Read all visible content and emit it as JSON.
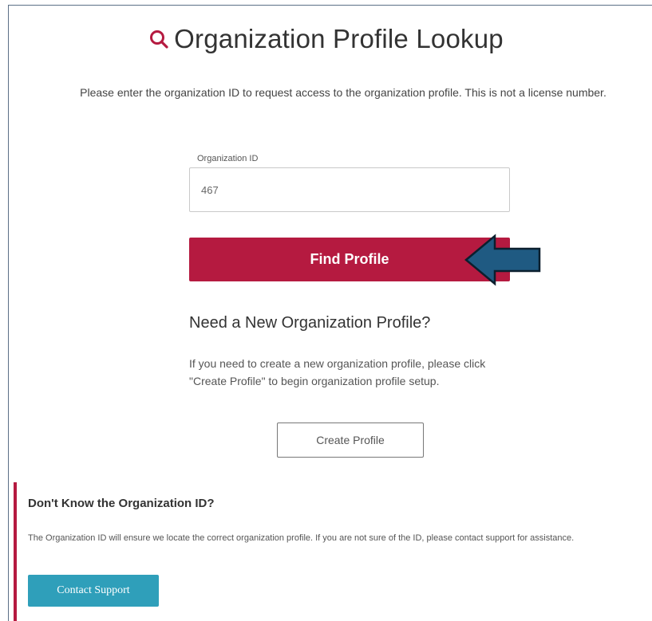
{
  "page": {
    "title": "Organization Profile Lookup",
    "intro": "Please enter the organization ID to request access to the organization profile. This is not a license number."
  },
  "lookup": {
    "field_label": "Organization ID",
    "field_value": "467",
    "find_button": "Find Profile"
  },
  "new_profile": {
    "heading": "Need a New Organization Profile?",
    "text": "If you need to create a new organization profile, please click \"Create Profile\" to begin organization profile setup.",
    "create_button": "Create Profile"
  },
  "help": {
    "heading": "Don't Know the Organization ID?",
    "text": "The Organization ID will ensure we locate the correct organization profile. If you are not sure of the ID, please contact support for assistance.",
    "contact_button": "Contact Support"
  },
  "colors": {
    "primary": "#b51a40",
    "support": "#2f9fba",
    "annotation_arrow": "#1f5a82"
  },
  "icons": {
    "title_icon": "search-icon",
    "annotation": "arrow-left-icon"
  }
}
